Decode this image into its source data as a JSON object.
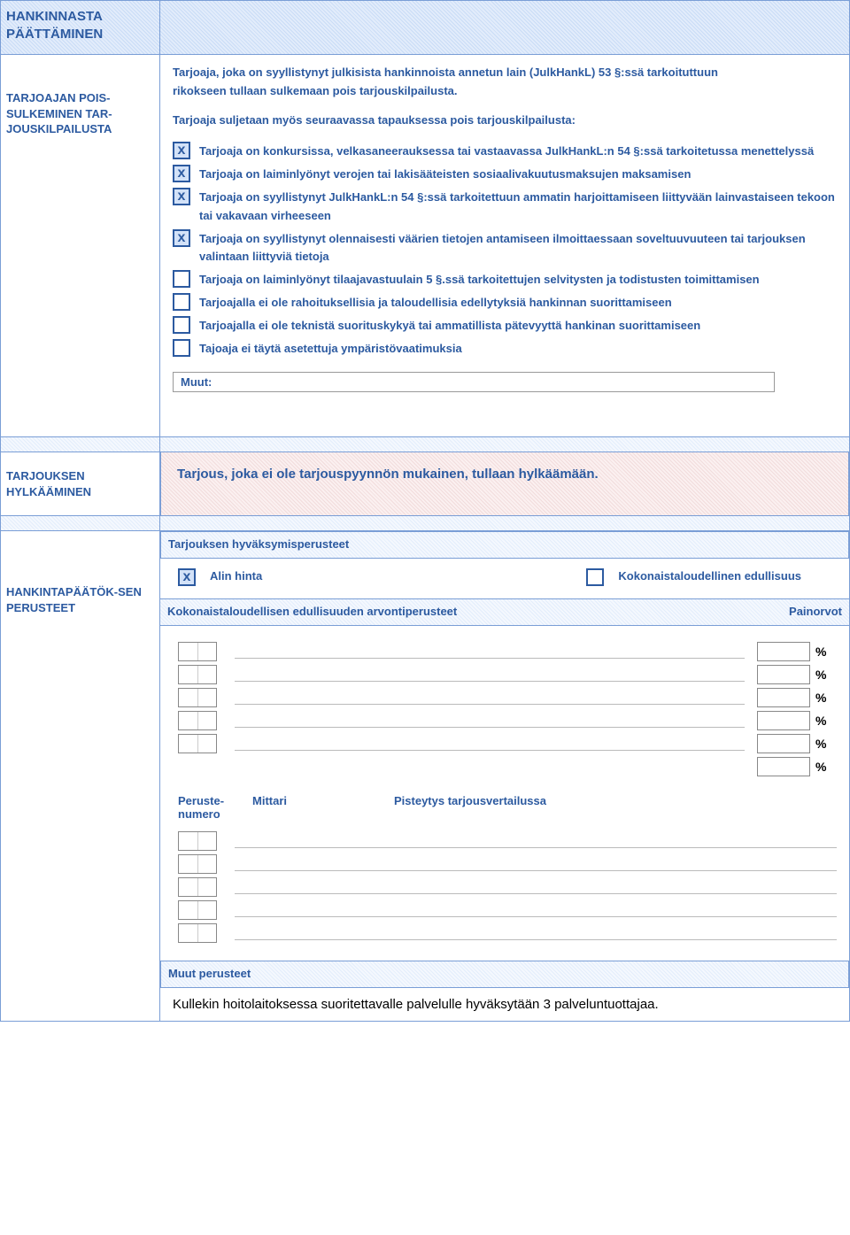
{
  "section1": {
    "title": "HANKINNASTA PÄÄTTÄMINEN",
    "label": "TARJOAJAN POIS-SULKEMINEN TAR-JOUSKILPAILUSTA",
    "intro1": "Tarjoaja, joka on syyllistynyt julkisista hankinnoista annetun lain (JulkHankL) 53 §:ssä tarkoituttuun",
    "intro2": "rikokseen tullaan sulkemaan pois tarjouskilpailusta.",
    "intro3": "Tarjoaja suljetaan myös seuraavassa tapauksessa pois tarjouskilpailusta:",
    "items": [
      {
        "checked": true,
        "text": "Tarjoaja on konkursissa, velkasaneerauksessa tai vastaavassa JulkHankL:n 54 §:ssä tarkoitetussa menettelyssä"
      },
      {
        "checked": true,
        "text": "Tarjoaja on laiminlyönyt verojen tai lakisääteisten sosiaalivakuutusmaksujen maksamisen"
      },
      {
        "checked": true,
        "text": "Tarjoaja on syyllistynyt JulkHankL:n 54 §:ssä tarkoitettuun ammatin harjoittamiseen liittyvään lainvastaiseen tekoon tai vakavaan virheeseen"
      },
      {
        "checked": true,
        "text": "Tarjoaja on syyllistynyt olennaisesti väärien tietojen antamiseen ilmoittaessaan soveltuuvuuteen tai tarjouksen valintaan liittyviä tietoja"
      },
      {
        "checked": false,
        "text": "Tarjoaja on laiminlyönyt tilaajavastuulain 5 §.ssä tarkoitettujen selvitysten ja todistusten toimittamisen"
      },
      {
        "checked": false,
        "text": "Tarjoajalla ei ole rahoituksellisia ja taloudellisia edellytyksiä hankinnan suorittamiseen"
      },
      {
        "checked": false,
        "text": "Tarjoajalla ei ole teknistä suorituskykyä tai ammatillista pätevyyttä hankinan suorittamiseen"
      },
      {
        "checked": false,
        "text": "Tajoaja ei täytä asetettuja ympäristövaatimuksia"
      }
    ],
    "muut": "Muut:"
  },
  "section2": {
    "label": "TARJOUKSEN HYLKÄÄMINEN",
    "text": "Tarjous, joka ei ole tarjouspyynnön mukainen, tullaan hylkäämään."
  },
  "section3": {
    "label": "HANKINTAPÄÄTÖK-SEN PERUSTEET",
    "subhead": "Tarjouksen hyväksymisperusteet",
    "opt1_checked": true,
    "opt1": "Alin hinta",
    "opt2_checked": false,
    "opt2": "Kokonaistaloudellinen edullisuus",
    "criteria_head": "Kokonaistaloudellisen edullisuuden arvontiperusteet",
    "weights_head": "Painorvot",
    "pct": "%",
    "mittari": {
      "c1a": "Peruste-",
      "c1b": "numero",
      "c2": "Mittari",
      "c3": "Pisteytys tarjousvertailussa"
    },
    "muut_perusteet": "Muut perusteet",
    "footer": "Kullekin hoitolaitoksessa suoritettavalle palvelulle hyväksytään 3 palveluntuottajaa."
  }
}
